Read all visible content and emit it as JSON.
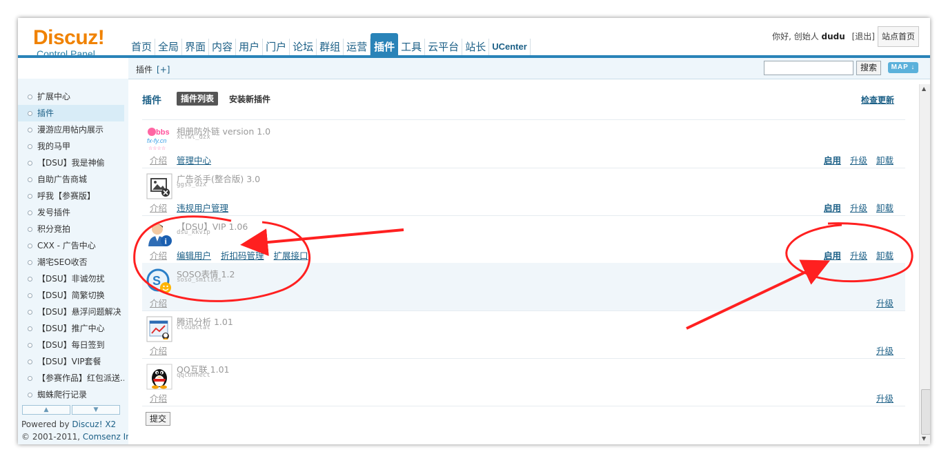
{
  "header": {
    "logo_main": "Discuz!",
    "logo_sub": "Control Panel",
    "nav": [
      {
        "label": "首页"
      },
      {
        "label": "全局"
      },
      {
        "label": "界面"
      },
      {
        "label": "内容"
      },
      {
        "label": "用户"
      },
      {
        "label": "门户"
      },
      {
        "label": "论坛"
      },
      {
        "label": "群组"
      },
      {
        "label": "运营"
      },
      {
        "label": "插件",
        "active": true
      },
      {
        "label": "工具"
      },
      {
        "label": "云平台"
      },
      {
        "label": "站长"
      },
      {
        "label": "UCenter"
      }
    ],
    "greeting": "你好, 创始人 ",
    "username": "dudu",
    "logout": "[退出]",
    "site_home": "站点首页"
  },
  "subbar": {
    "crumb": "插件",
    "crumb_plus": "[+]",
    "search_value": "",
    "search_button": "搜索",
    "map_button": "MAP ↓"
  },
  "sidebar": {
    "items": [
      {
        "label": "扩展中心"
      },
      {
        "label": "插件",
        "active": true
      },
      {
        "label": "漫游应用帖内展示"
      },
      {
        "label": "我的马甲"
      },
      {
        "label": "【DSU】我是神偷"
      },
      {
        "label": "自助广告商城"
      },
      {
        "label": "呼我【参赛版】"
      },
      {
        "label": "发号插件"
      },
      {
        "label": "积分竞拍"
      },
      {
        "label": "CXX - 广告中心"
      },
      {
        "label": "潮宅SEO收否"
      },
      {
        "label": "【DSU】非诚勿扰"
      },
      {
        "label": "【DSU】简繁切换"
      },
      {
        "label": "【DSU】悬浮问题解决"
      },
      {
        "label": "【DSU】推广中心"
      },
      {
        "label": "【DSU】每日签到"
      },
      {
        "label": "【DSU】VIP套餐"
      },
      {
        "label": "【参赛作品】红包派送..."
      },
      {
        "label": "蜘蛛爬行记录"
      }
    ],
    "powered_prefix": "Powered by ",
    "powered_link": "Discuz! X2",
    "copyright_prefix": "© 2001-2011, ",
    "copyright_link": "Comsenz Inc."
  },
  "main": {
    "title": "插件",
    "tab_list": "插件列表",
    "tab_install": "安装新插件",
    "check_update": "检查更新",
    "intro_label": "介绍",
    "submit": "提交",
    "plugins": [
      {
        "name": "相册防外链 version 1.0",
        "id": "xcfwl_dzx",
        "icon": "bbs-logo-icon",
        "links": [
          "管理中心"
        ],
        "actions": [
          "启用",
          "升级",
          "卸载"
        ],
        "alt": false
      },
      {
        "name": "广告杀手(整合版) 3.0",
        "id": "ggss_dzx",
        "icon": "image-placeholder-icon",
        "links": [
          "违规用户管理"
        ],
        "actions": [
          "启用",
          "升级",
          "卸载"
        ],
        "alt": false
      },
      {
        "name": "【DSU】VIP 1.06",
        "id": "dsu_kkvip",
        "icon": "user-info-icon",
        "links": [
          "编辑用户",
          "折扣码管理",
          "扩展接口"
        ],
        "actions": [
          "启用",
          "升级",
          "卸载"
        ],
        "alt": false
      },
      {
        "name": "SOSO表情 1.2",
        "id": "soso_smilies",
        "icon": "soso-smile-icon",
        "links": [],
        "actions": [
          "升级"
        ],
        "alt": true
      },
      {
        "name": "腾讯分析 1.01",
        "id": "cloudstat",
        "icon": "analytics-chart-icon",
        "links": [],
        "actions": [
          "升级"
        ],
        "alt": false
      },
      {
        "name": "QQ互联 1.01",
        "id": "qqconnect",
        "icon": "qq-penguin-icon",
        "links": [],
        "actions": [
          "升级"
        ],
        "alt": false
      }
    ]
  },
  "colors": {
    "brand_orange": "#f08200",
    "nav_blue": "#2983b8",
    "link_blue": "#1b5f86",
    "annotation_red": "#ff2020"
  }
}
